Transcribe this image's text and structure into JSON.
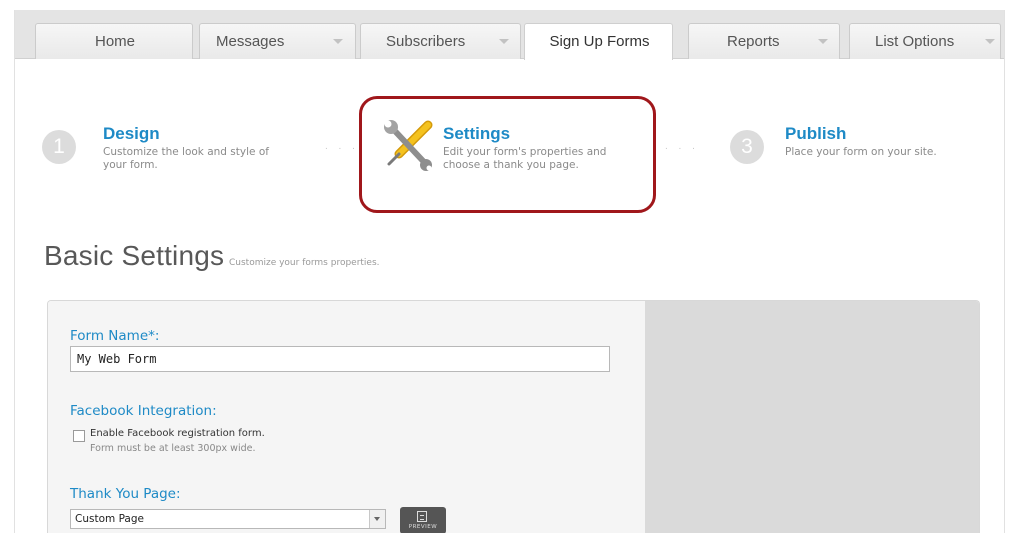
{
  "tabs": [
    {
      "label": "Home",
      "has_dropdown": false,
      "active": false
    },
    {
      "label": "Messages",
      "has_dropdown": true,
      "active": false
    },
    {
      "label": "Subscribers",
      "has_dropdown": true,
      "active": false
    },
    {
      "label": "Sign Up Forms",
      "has_dropdown": false,
      "active": true
    },
    {
      "label": "Reports",
      "has_dropdown": true,
      "active": false
    },
    {
      "label": "List Options",
      "has_dropdown": true,
      "active": false
    }
  ],
  "steps": [
    {
      "number": "1",
      "title": "Design",
      "desc_line1": "Customize the look and style of",
      "desc_line2": "your form."
    },
    {
      "title": "Settings",
      "icon": "wrench-screwdriver-icon",
      "desc_line1": "Edit your form's properties and",
      "desc_line2": "choose a thank you page."
    },
    {
      "number": "3",
      "title": "Publish",
      "desc_line1": "Place your form on your site."
    }
  ],
  "step_separator": ". . .",
  "page": {
    "title": "Basic Settings",
    "subtitle": "Customize your forms properties."
  },
  "form": {
    "name_label": "Form Name*:",
    "name_value": "My Web Form",
    "facebook_label": "Facebook Integration:",
    "facebook_checkbox_label": "Enable Facebook registration form.",
    "facebook_checkbox_checked": false,
    "facebook_hint": "Form must be at least 300px wide.",
    "thank_you_label": "Thank You Page:",
    "thank_you_selected": "Custom Page",
    "preview_label": "PREVIEW"
  },
  "colors": {
    "accent": "#1e8ac6",
    "highlight_border": "#a0171b",
    "tab_bar": "#e4e4e4",
    "preview_area": "#dadada"
  }
}
